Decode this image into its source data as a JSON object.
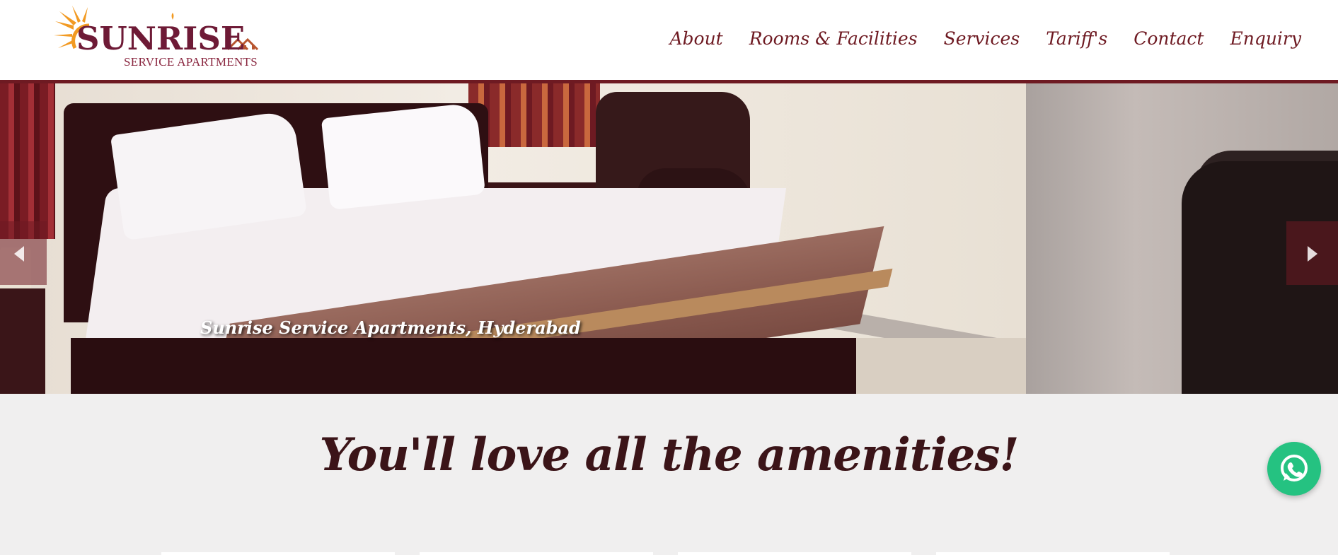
{
  "brand": {
    "name": "SUNRISE",
    "tagline": "SERVICE APARTMENTS",
    "color": "#6e1a36",
    "accent": "#f29a22"
  },
  "nav": {
    "items": [
      {
        "label": "About"
      },
      {
        "label": "Rooms & Facilities"
      },
      {
        "label": "Services"
      },
      {
        "label": "Tariff's"
      },
      {
        "label": "Contact"
      },
      {
        "label": "Enquiry"
      }
    ]
  },
  "hero": {
    "caption": "Sunrise Service Apartments, Hyderabad",
    "prev_icon": "chevron-left-icon",
    "next_icon": "chevron-right-icon"
  },
  "section": {
    "title": "You'll love all the amenities!"
  },
  "floating": {
    "whatsapp_icon": "whatsapp-icon",
    "color": "#25c281"
  },
  "theme": {
    "primary": "#6e1a22",
    "background": "#f0efef"
  }
}
